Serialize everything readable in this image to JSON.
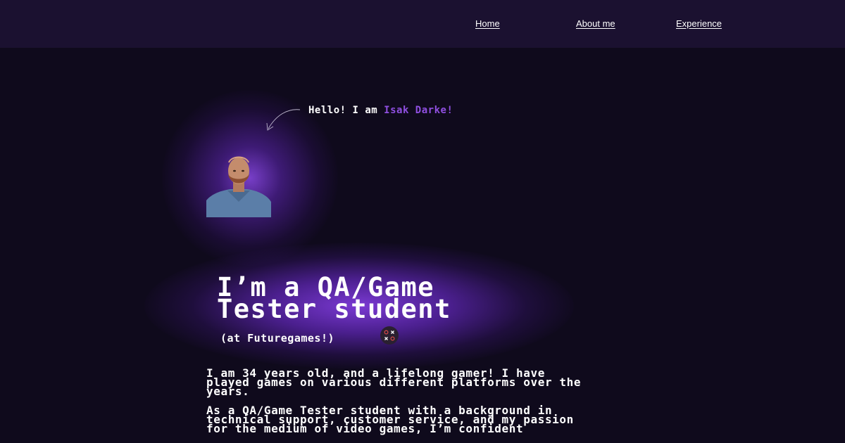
{
  "nav": {
    "items": [
      {
        "label": "Home"
      },
      {
        "label": "About me"
      },
      {
        "label": "Experience"
      }
    ]
  },
  "hero": {
    "greeting_prefix": "Hello! I am ",
    "greeting_name": "Isak Darke!",
    "title_line1": "I’m a QA/Game",
    "title_line2": "Tester student",
    "subtitle": "(at Futuregames!)",
    "logo_icon": "futuregames-logo-icon"
  },
  "about": {
    "paragraphs": [
      "I am 34 years old, and a lifelong gamer! I have played games on various different platforms over the years.",
      "As a QA/Game Tester student with a background in technical support, customer service, and my passion for the medium of video games, I’m confident"
    ]
  },
  "colors": {
    "background": "#0f0a1c",
    "navbar": "#1b1130",
    "accent": "#8f4fe0",
    "glow": "#8a48e6"
  }
}
